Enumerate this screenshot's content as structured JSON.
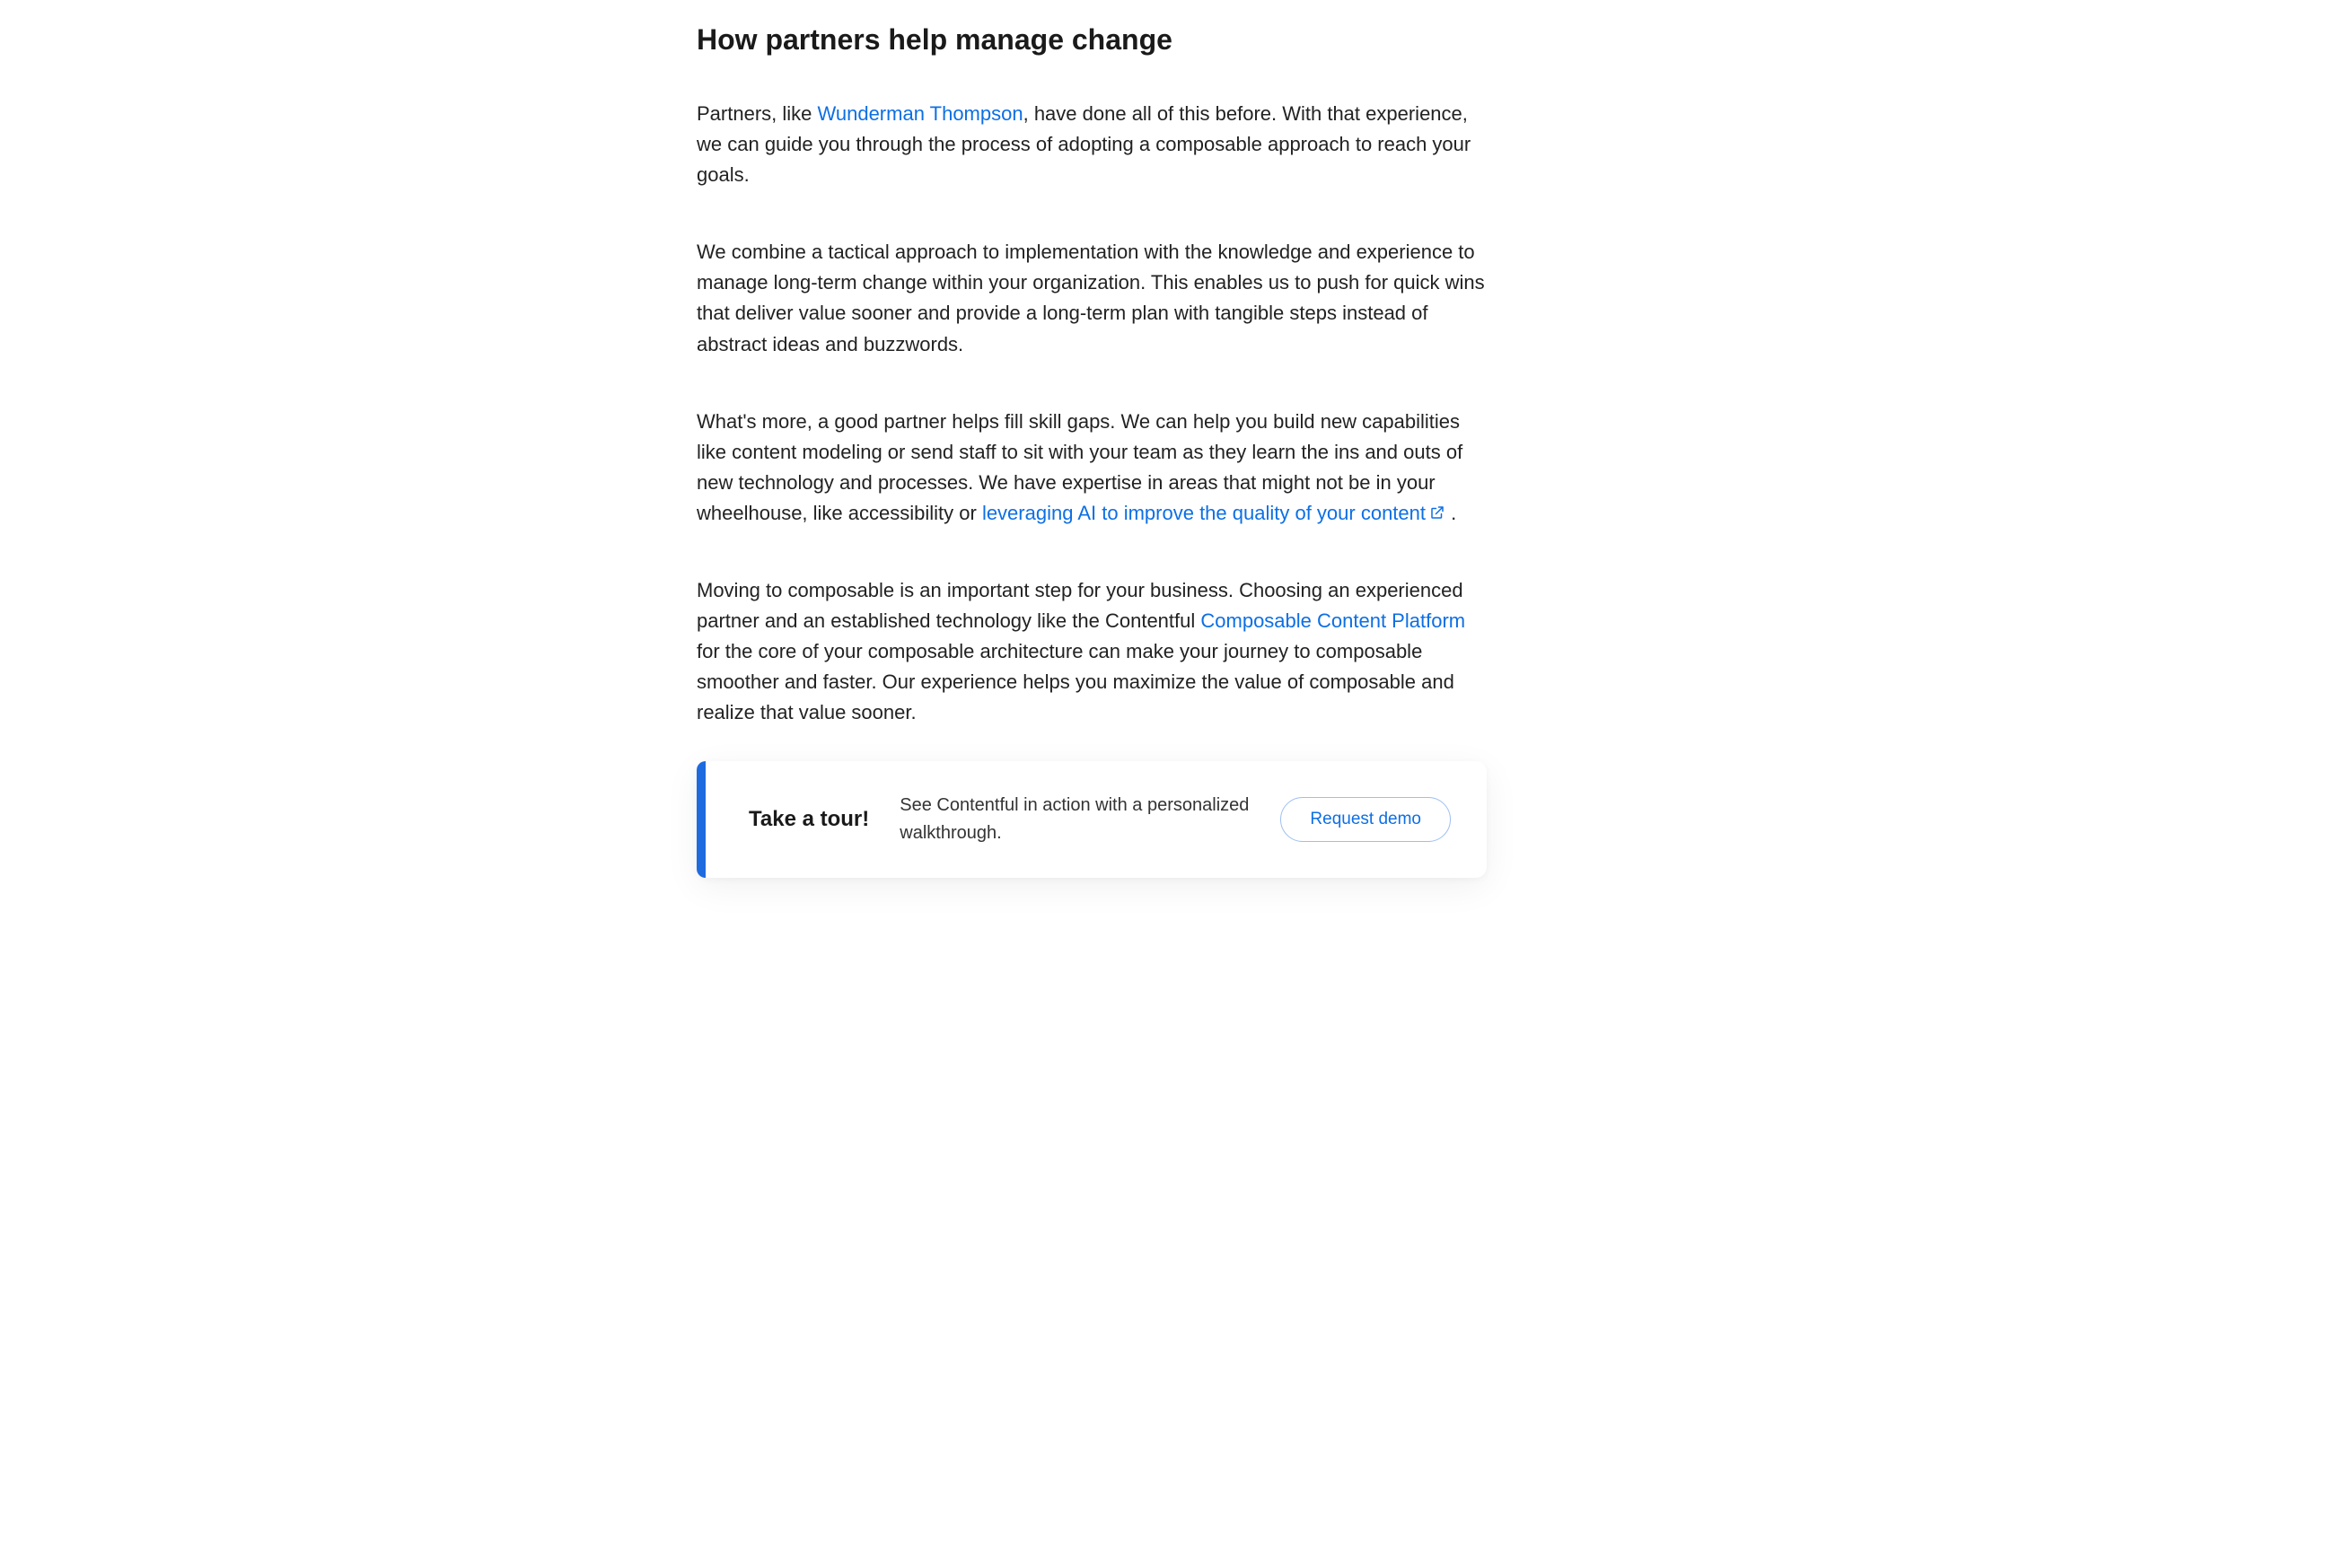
{
  "heading": "How partners help manage change",
  "paragraphs": {
    "p1_pre": "Partners, like ",
    "p1_link": "Wunderman Thompson",
    "p1_post": ", have done all of this before. With that experience, we can guide you through the process of adopting a composable approach to reach your goals.",
    "p2": "We combine a tactical approach to implementation with the knowledge and experience to manage long-term change within your organization. This enables us to push for quick wins that deliver value sooner and provide a long-term plan with tangible steps instead of abstract ideas and buzzwords.",
    "p3_pre": "What's more, a good partner helps fill skill gaps. We can help you build new capabilities like content modeling or send staff to sit with your team as they learn the ins and outs of new technology and processes. We have expertise in areas that might not be in your wheelhouse, like accessibility or ",
    "p3_link": "leveraging AI to improve the quality of your content",
    "p3_post": " .",
    "p4_pre": "Moving to composable is an important step for your business. Choosing an experienced partner and an established technology like the Contentful ",
    "p4_link": "Composable Content Platform",
    "p4_post": " for the core of your composable architecture can make your journey to composable smoother and faster. Our experience helps you maximize the value of composable and realize that value sooner."
  },
  "cta": {
    "title": "Take a tour!",
    "text": "See Contentful in action with a personalized walkthrough.",
    "button": "Request demo"
  },
  "colors": {
    "link": "#0d6fe4",
    "accent_bar": "#1e6be0"
  }
}
